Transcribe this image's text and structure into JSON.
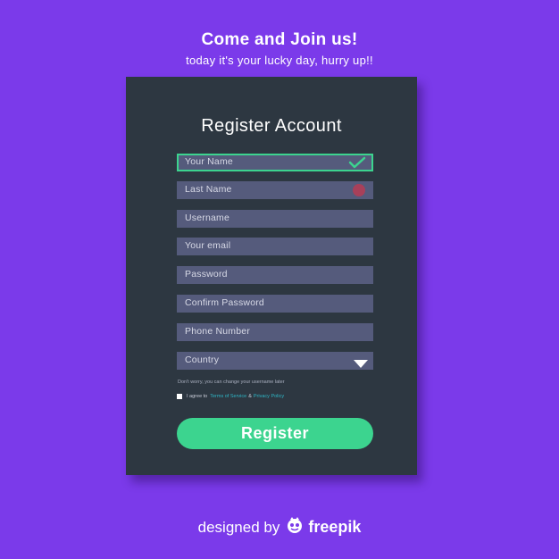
{
  "header": {
    "title": "Come and Join us!",
    "subtitle": "today it's your lucky day, hurry up!!"
  },
  "form": {
    "title": "Register Account",
    "fields": [
      {
        "placeholder": "Your Name",
        "state": "valid"
      },
      {
        "placeholder": "Last Name",
        "state": "error"
      },
      {
        "placeholder": "Username",
        "state": "default"
      },
      {
        "placeholder": "Your email",
        "state": "default"
      },
      {
        "placeholder": "Password",
        "state": "default"
      },
      {
        "placeholder": "Confirm Password",
        "state": "default"
      },
      {
        "placeholder": "Phone Number",
        "state": "default"
      },
      {
        "placeholder": "Country",
        "state": "dropdown"
      }
    ],
    "hint": "Don't worry, you can change your username later",
    "agree": {
      "prefix": "I agree to",
      "terms_link": "Terms of Service",
      "ampersand": "&",
      "privacy_link": "Privacy Policy"
    },
    "submit_label": "Register"
  },
  "credit": {
    "prefix": "designed by",
    "brand": "freepik"
  },
  "colors": {
    "background": "#7b3aea",
    "card": "#2d3741",
    "field": "#555b7c",
    "accent_green": "#3cd48f",
    "error_red": "#a8405a",
    "link": "#2fb7c7"
  },
  "icons": {
    "valid": "check-icon",
    "error": "error-icon",
    "dropdown": "caret-down-icon",
    "brand_logo": "freepik-logo-icon"
  }
}
